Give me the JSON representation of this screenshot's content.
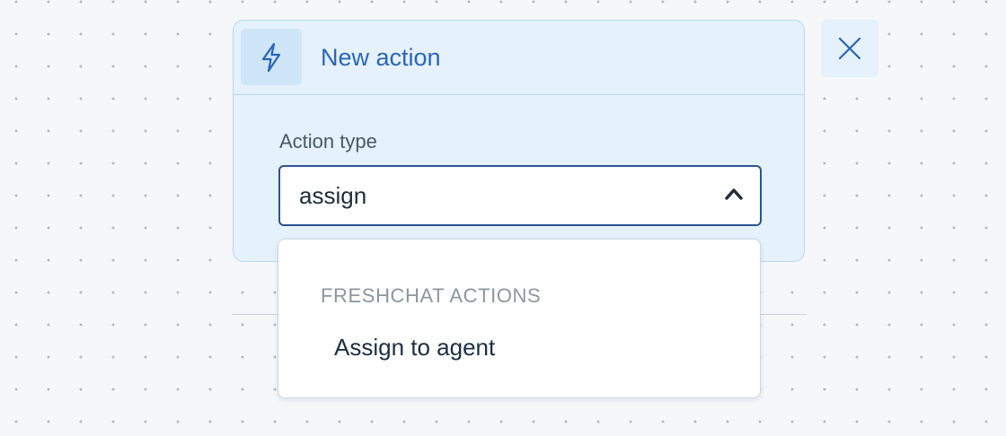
{
  "card": {
    "title": "New action",
    "icon": "bolt-icon"
  },
  "field": {
    "label": "Action type",
    "value": "assign",
    "toggle_icon": "chevron-up-icon"
  },
  "close": {
    "icon": "close-icon"
  },
  "dropdown": {
    "group_label": "FRESHCHAT ACTIONS",
    "options": [
      {
        "label": "Assign to agent"
      }
    ]
  },
  "colors": {
    "accent": "#2966b8",
    "card_bg": "#e5f1fc",
    "focus_border": "#2c5391",
    "text_dark": "#1b2f45",
    "muted": "#8d969e"
  }
}
